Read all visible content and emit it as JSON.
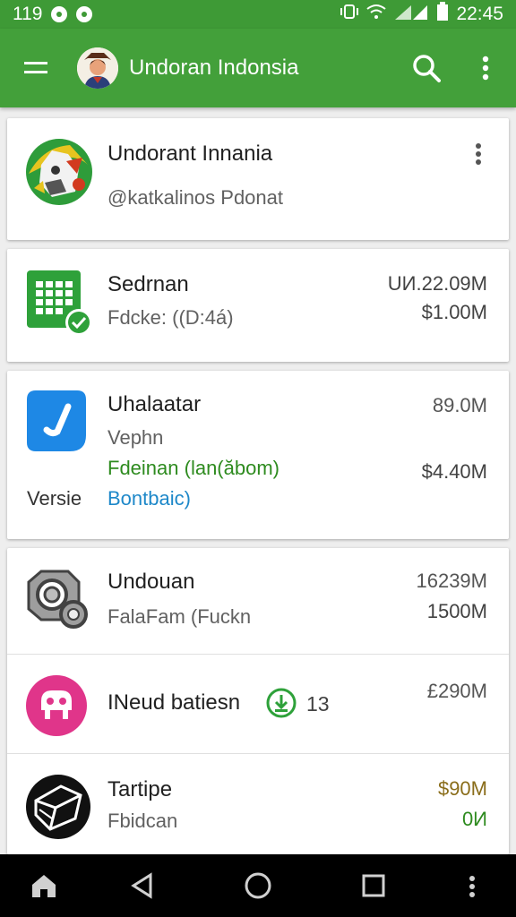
{
  "status_bar": {
    "time_left": "119",
    "time_right": "22:45",
    "icons": [
      "notification-icon",
      "shield-icon",
      "vibrate-icon",
      "wifi-icon",
      "signal-icon",
      "battery-icon"
    ]
  },
  "app_bar": {
    "title": "Undoran Indonsia",
    "icons": [
      "menu-icon",
      "avatar",
      "search-icon",
      "more-vert-icon"
    ]
  },
  "profile": {
    "name": "Undorant Innania",
    "handle": "@katkalinos Pdonat"
  },
  "items": [
    {
      "title": "Sedrnan",
      "subtitle": "Fdcke: ((D:4á)",
      "amount_primary": "UИ.22.09M",
      "amount_secondary": "$1.00M",
      "icon": "spreadsheet-check-icon"
    },
    {
      "title": "Uhalaatar",
      "subtitle": "Vephn",
      "link_green": "Fdeinan (lan(ăbom)",
      "link_blue": "Bontbaic)",
      "side_label": "Versie",
      "amount_primary": "89.0M",
      "amount_secondary": "$4.40M",
      "icon": "check-badge-icon"
    },
    {
      "title": "Undouan",
      "subtitle": "FalaFam (Fuckn",
      "amount_primary": "16239M",
      "amount_secondary": "1500M",
      "icon": "gear-icon"
    },
    {
      "title": "INeud batiesn",
      "badge_count": "13",
      "amount_primary": "£290M",
      "icon": "robot-icon",
      "badge_icon": "download-circle-icon"
    },
    {
      "title": "Tartipe",
      "subtitle": "Fbidcan",
      "amount_primary": "$90M",
      "amount_secondary": "0И",
      "icon": "cube-icon"
    }
  ],
  "colors": {
    "app_bar": "#43a03a",
    "status_bar": "#3e9a36",
    "accent_green": "#2e8b1f",
    "accent_blue": "#1e88c9",
    "amount_gold": "#8a6d1a"
  }
}
